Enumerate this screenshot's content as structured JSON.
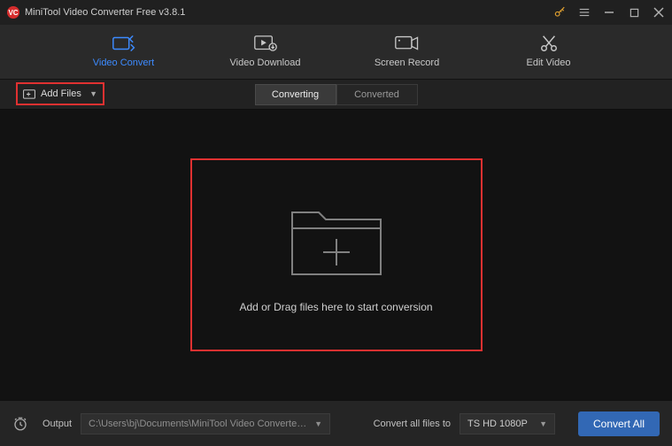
{
  "title": "MiniTool Video Converter Free v3.8.1",
  "tabs": {
    "video_convert": "Video Convert",
    "video_download": "Video Download",
    "screen_record": "Screen Record",
    "edit_video": "Edit Video"
  },
  "add_files_label": "Add Files",
  "sub_tabs": {
    "converting": "Converting",
    "converted": "Converted"
  },
  "drop_text": "Add or Drag files here to start conversion",
  "bottom": {
    "output_label": "Output",
    "output_path": "C:\\Users\\bj\\Documents\\MiniTool Video Converter\\output",
    "convert_all_label": "Convert all files to",
    "format": "TS HD 1080P",
    "convert_btn": "Convert All"
  }
}
